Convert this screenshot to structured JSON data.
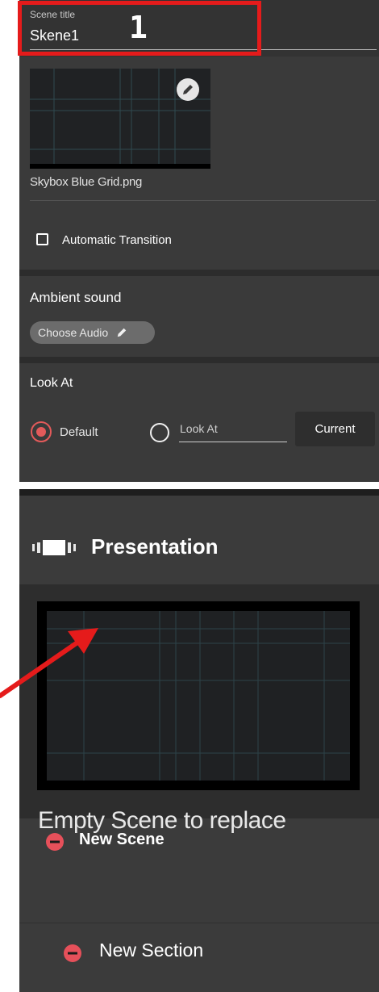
{
  "scene_panel": {
    "title_label": "Scene title",
    "title_value": "Skene1",
    "callout_number": "1",
    "skybox_file": "Skybox Blue Grid.png",
    "auto_transition_label": "Automatic Transition"
  },
  "ambient": {
    "title": "Ambient sound",
    "choose_audio_label": "Choose Audio"
  },
  "look_at": {
    "title": "Look At",
    "option_default": "Default",
    "option_lookat_placeholder": "Look At",
    "current_button": "Current"
  },
  "presentation": {
    "title": "Presentation",
    "empty_scene_text": "Empty Scene to replace",
    "new_scene_label": "New Scene",
    "new_section_label": "New Section"
  },
  "colors": {
    "highlight_red": "#e51b1b",
    "radio_accent": "#e35a5a",
    "plus_icon_red": "#e6505a"
  }
}
